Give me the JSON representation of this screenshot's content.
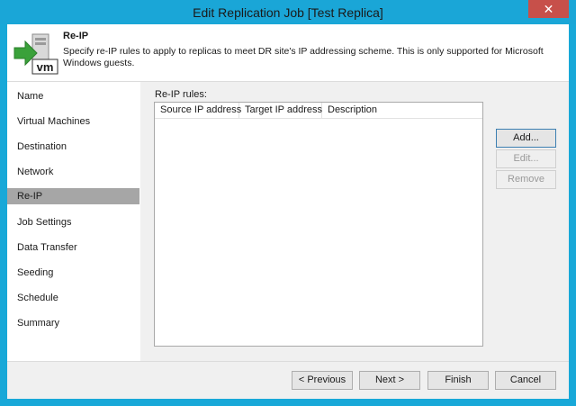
{
  "window": {
    "title": "Edit Replication Job [Test Replica]",
    "close_glyph": "✕"
  },
  "header": {
    "title": "Re-IP",
    "description": "Specify re-IP rules to apply to replicas to meet DR site's IP addressing scheme. This is only supported for Microsoft Windows guests.",
    "icon": "vm-replica-icon",
    "icon_text": "vm"
  },
  "nav": {
    "items": [
      {
        "label": "Name"
      },
      {
        "label": "Virtual Machines"
      },
      {
        "label": "Destination"
      },
      {
        "label": "Network"
      },
      {
        "label": "Re-IP",
        "selected": true
      },
      {
        "label": "Job Settings"
      },
      {
        "label": "Data Transfer"
      },
      {
        "label": "Seeding"
      },
      {
        "label": "Schedule"
      },
      {
        "label": "Summary"
      }
    ]
  },
  "main": {
    "rules_label": "Re-IP rules:",
    "columns": [
      "Source IP address",
      "Target IP address",
      "Description"
    ],
    "rows": [],
    "buttons": {
      "add": "Add...",
      "edit": "Edit...",
      "remove": "Remove"
    }
  },
  "footer": {
    "previous": "< Previous",
    "next": "Next >",
    "finish": "Finish",
    "cancel": "Cancel"
  },
  "colors": {
    "titlebar": "#1aa6d7",
    "close": "#c7504a",
    "selected_nav": "#a6a6a6",
    "icon_green": "#3aa13a"
  }
}
